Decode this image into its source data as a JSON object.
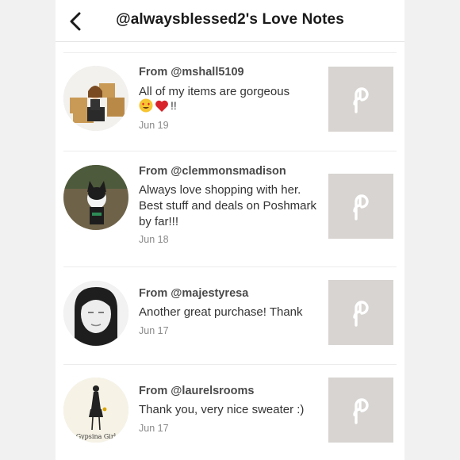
{
  "header": {
    "title": "@alwaysblessed2's Love Notes"
  },
  "notes": [
    {
      "from": "From @mshall5109",
      "message": "All of my items are gorgeous",
      "emoji_suffix": "!!",
      "date": "Jun 19"
    },
    {
      "from": "From @clemmonsmadison",
      "message": "Always love shopping with her. Best stuff and deals on Poshmark by far!!!",
      "date": "Jun 18"
    },
    {
      "from": "From @majestyresa",
      "message": "Another great purchase! Thank",
      "date": "Jun 17"
    },
    {
      "from": "From @laurelsrooms",
      "message": "Thank you, very nice sweater :)",
      "date": "Jun 17"
    }
  ],
  "avatar_texts": {
    "laurelsrooms_caption": "Gypsina Girl"
  },
  "icons": {
    "back": "chevron-left-icon",
    "emoji_1": "heart-eyes-emoji-icon",
    "emoji_2": "red-heart-emoji-icon",
    "thumb": "poshmark-logo-icon"
  },
  "colors": {
    "thumb_bg": "#d7d4d1",
    "heart": "#d8232a",
    "title": "#1a1a1a"
  }
}
